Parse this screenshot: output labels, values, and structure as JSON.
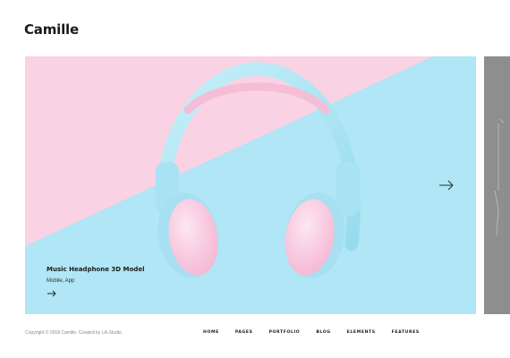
{
  "brand": {
    "logo": "Camille"
  },
  "slide": {
    "title": "Music Headphone 3D Model",
    "subtitle": "Mobile, App",
    "colors": {
      "pink": "#f9d2e4",
      "blue": "#b0e6f5"
    }
  },
  "footer": {
    "copyright": "Copyright © 2018 Camille. Created by LA-Studio."
  },
  "nav": {
    "items": [
      {
        "label": "HOME"
      },
      {
        "label": "PAGES"
      },
      {
        "label": "PORTFOLIO"
      },
      {
        "label": "BLOG"
      },
      {
        "label": "ELEMENTS"
      },
      {
        "label": "FEATURES"
      }
    ]
  },
  "icons": {
    "caption_arrow": "arrow-right-icon",
    "next_arrow": "arrow-right-icon"
  }
}
